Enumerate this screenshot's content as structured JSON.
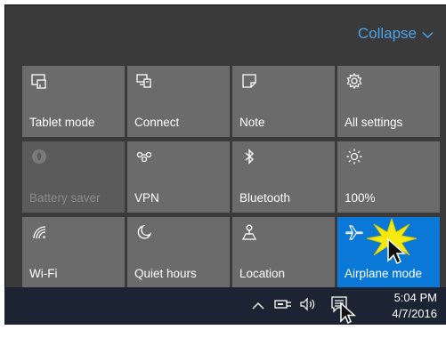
{
  "header": {
    "collapse_label": "Collapse",
    "chevron_icon": "chevron-down-icon"
  },
  "tiles": [
    {
      "label": "Tablet mode",
      "icon": "tablet-mode-icon",
      "state": "normal"
    },
    {
      "label": "Connect",
      "icon": "connect-icon",
      "state": "normal"
    },
    {
      "label": "Note",
      "icon": "note-icon",
      "state": "normal"
    },
    {
      "label": "All settings",
      "icon": "gear-icon",
      "state": "normal"
    },
    {
      "label": "Battery saver",
      "icon": "battery-saver-icon",
      "state": "disabled"
    },
    {
      "label": "VPN",
      "icon": "vpn-icon",
      "state": "normal"
    },
    {
      "label": "Bluetooth",
      "icon": "bluetooth-icon",
      "state": "normal"
    },
    {
      "label": "100%",
      "icon": "brightness-icon",
      "state": "normal"
    },
    {
      "label": "Wi-Fi",
      "icon": "wifi-icon",
      "state": "normal"
    },
    {
      "label": "Quiet hours",
      "icon": "moon-icon",
      "state": "normal"
    },
    {
      "label": "Location",
      "icon": "location-icon",
      "state": "normal"
    },
    {
      "label": "Airplane mode",
      "icon": "airplane-icon",
      "state": "active"
    }
  ],
  "taskbar": {
    "time": "5:04 PM",
    "date": "4/7/2016",
    "icons": [
      "chevron-up-icon",
      "network-icon",
      "volume-icon",
      "action-center-icon"
    ]
  },
  "colors": {
    "panel_bg": "#3a3a3a",
    "tile_bg": "#6b6b6b",
    "tile_active": "#0a78d7",
    "accent_text": "#4aa3ea",
    "taskbar_bg": "#1c2433",
    "highlight_burst": "#f5ea10"
  }
}
